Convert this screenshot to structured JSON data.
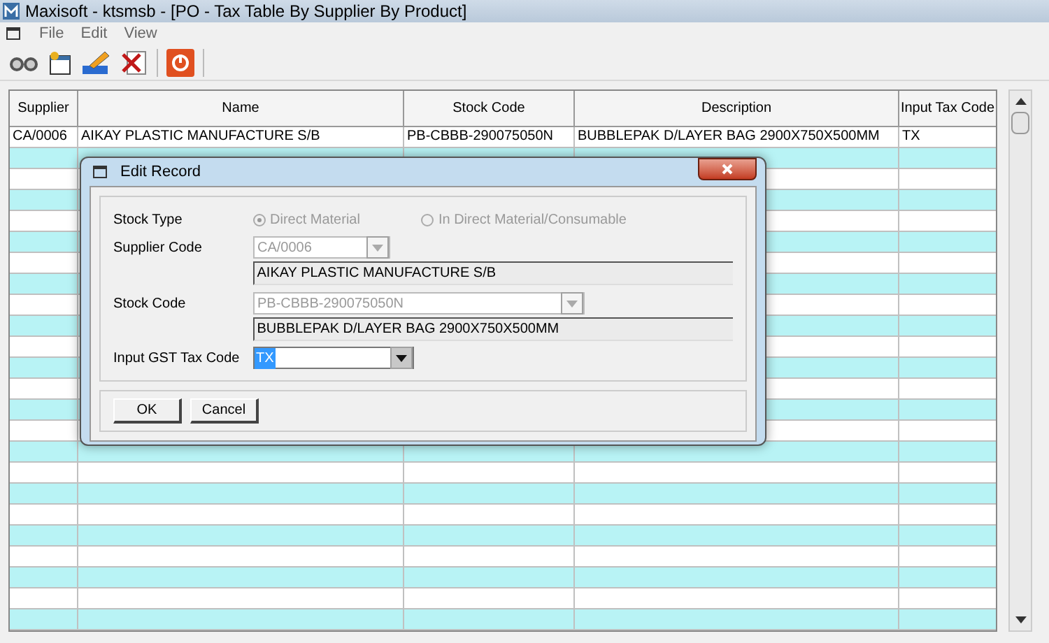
{
  "window": {
    "title": "Maxisoft - ktsmsb - [PO - Tax Table By Supplier By Product]"
  },
  "menu": [
    "File",
    "Edit",
    "View"
  ],
  "table": {
    "columns": [
      "Supplier",
      "Name",
      "Stock Code",
      "Description",
      "Input Tax Code"
    ],
    "rows": [
      [
        "CA/0006",
        "AIKAY PLASTIC MANUFACTURE S/B",
        "PB-CBBB-290075050N",
        "BUBBLEPAK D/LAYER BAG 2900X750X500MM",
        "TX"
      ]
    ]
  },
  "dialog": {
    "title": "Edit Record",
    "stock_type": {
      "label": "Stock Type",
      "options": [
        {
          "label": "Direct Material",
          "selected": true
        },
        {
          "label": "In Direct Material/Consumable",
          "selected": false
        }
      ]
    },
    "supplier_code": {
      "label": "Supplier Code",
      "value": "CA/0006",
      "description": "AIKAY PLASTIC MANUFACTURE S/B"
    },
    "stock_code": {
      "label": "Stock Code",
      "value": "PB-CBBB-290075050N",
      "description": "BUBBLEPAK D/LAYER BAG 2900X750X500MM"
    },
    "tax_code": {
      "label": "Input GST Tax Code",
      "value": "TX"
    },
    "buttons": [
      "OK",
      "Cancel"
    ]
  }
}
